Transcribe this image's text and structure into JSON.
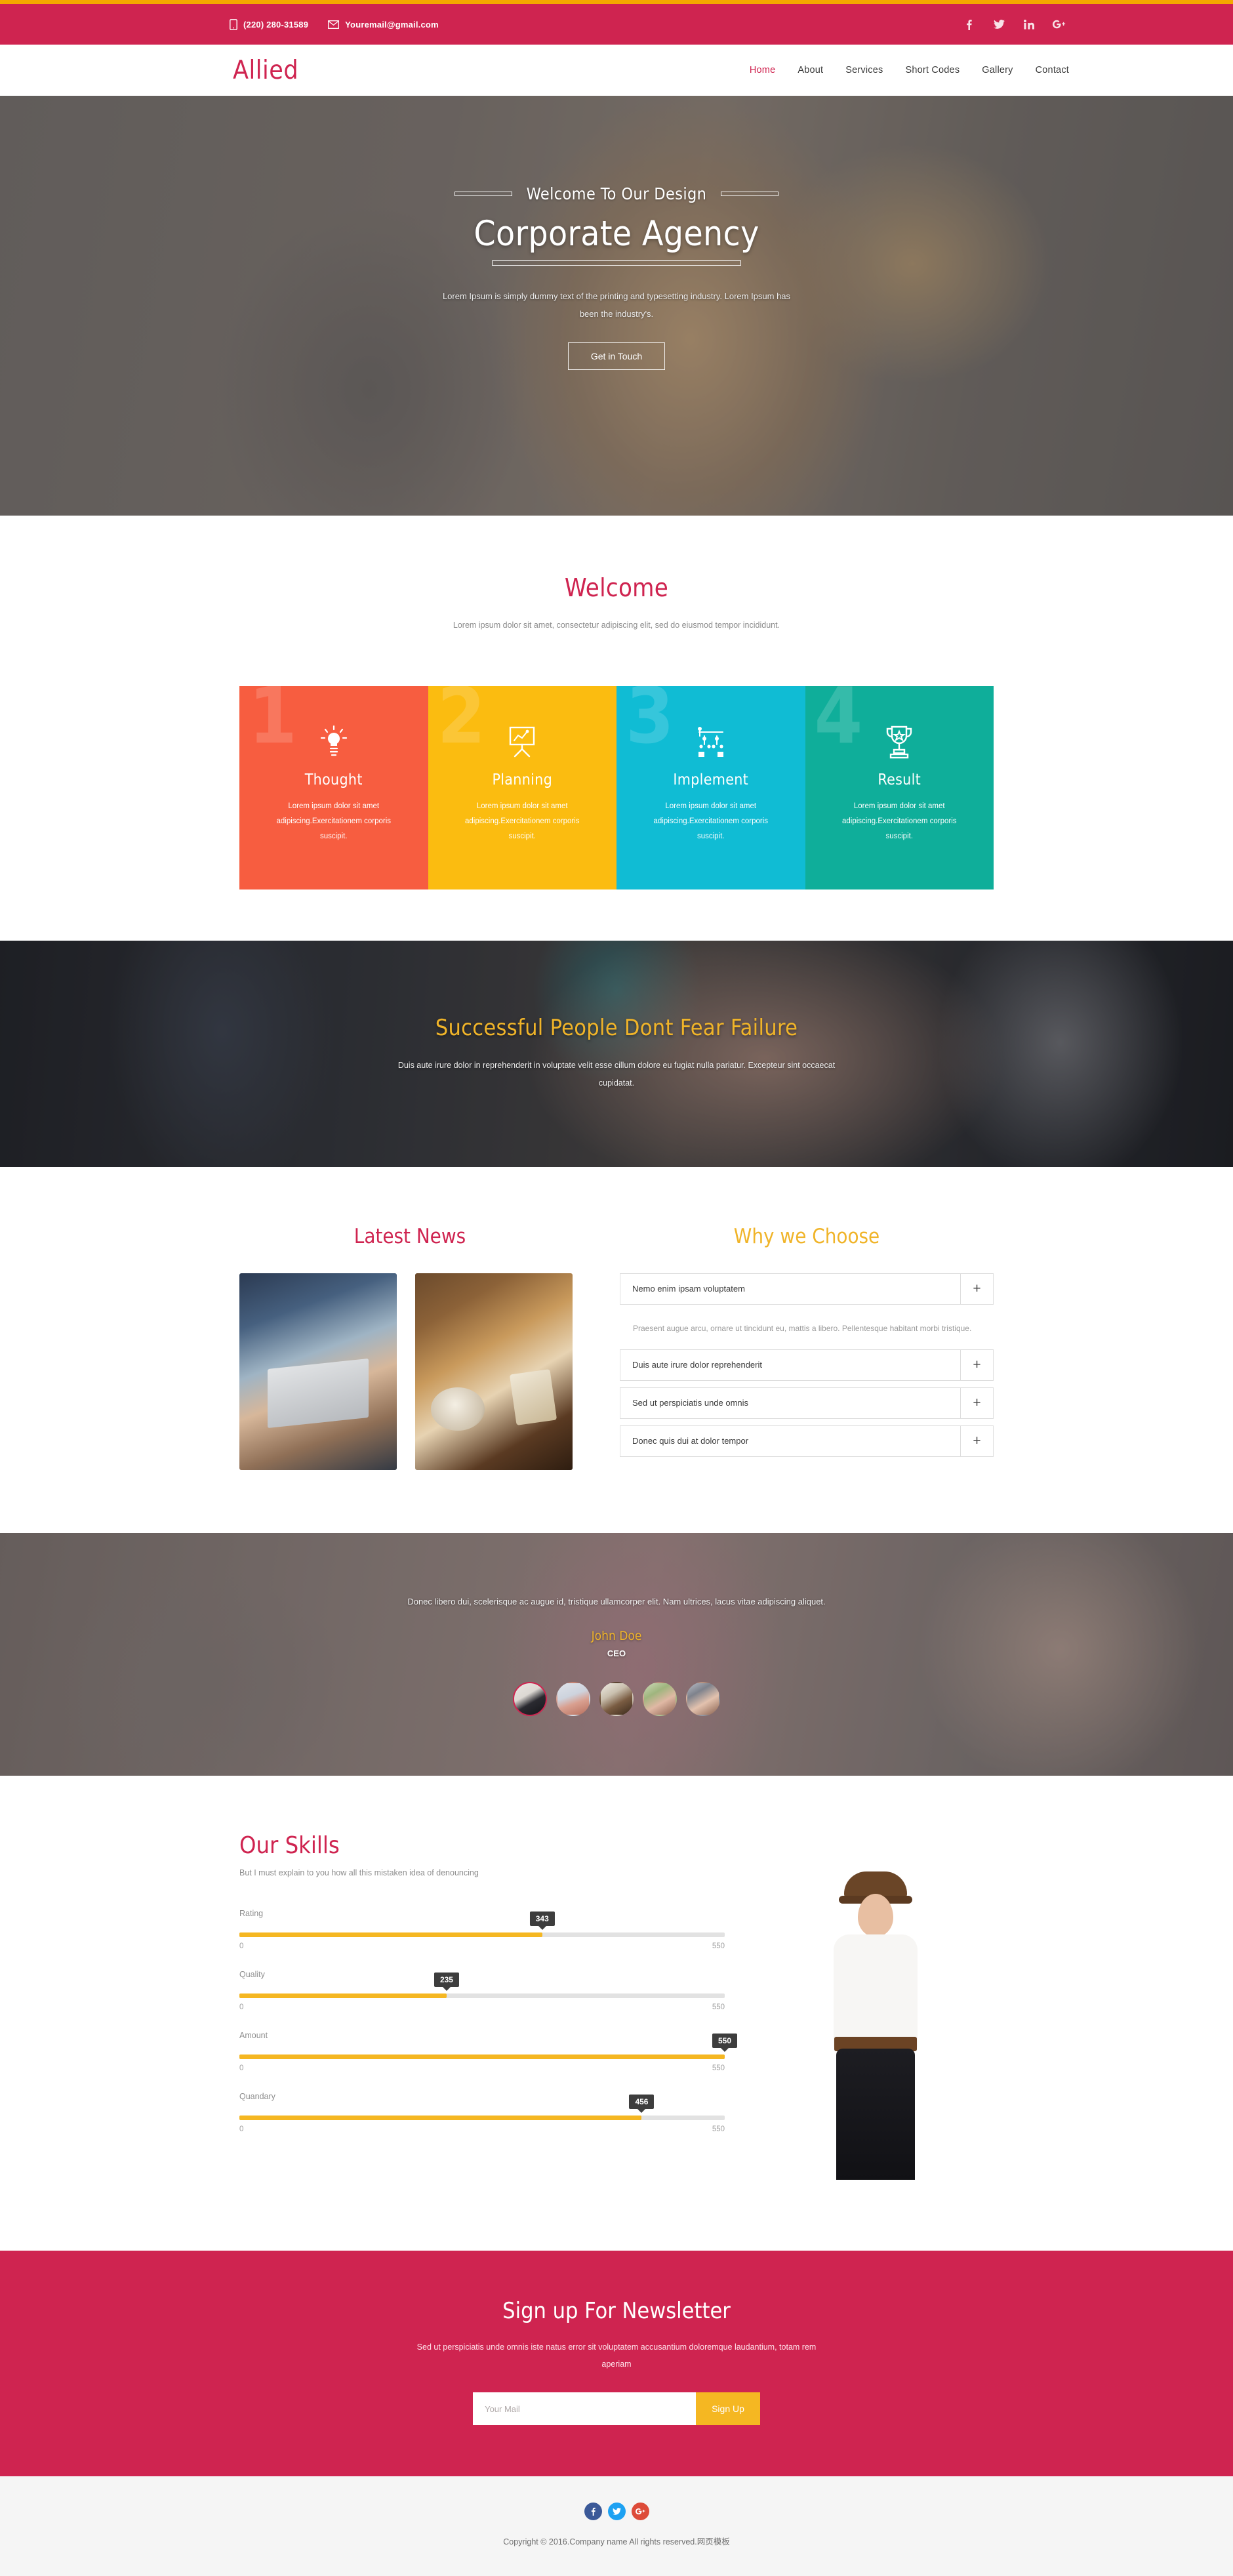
{
  "colors": {
    "brand_red": "#cf2450",
    "accent_yellow": "#f5b722",
    "card_orange": "#f75d40",
    "card_yellow": "#fbbc10",
    "card_cyan": "#10bcd4",
    "card_teal": "#0fae9a"
  },
  "topbar": {
    "phone": "(220) 280-31589",
    "email": "Youremail@gmail.com",
    "phone_icon": "mobile-phone-icon",
    "email_icon": "envelope-icon",
    "socials": [
      {
        "name": "facebook",
        "label": "f"
      },
      {
        "name": "twitter",
        "label": "t"
      },
      {
        "name": "linkedin",
        "label": "in"
      },
      {
        "name": "googleplus",
        "label": "g+"
      }
    ]
  },
  "header": {
    "logo": "Allied",
    "nav": [
      {
        "label": "Home",
        "active": true
      },
      {
        "label": "About",
        "active": false
      },
      {
        "label": "Services",
        "active": false
      },
      {
        "label": "Short Codes",
        "active": false
      },
      {
        "label": "Gallery",
        "active": false
      },
      {
        "label": "Contact",
        "active": false
      }
    ]
  },
  "hero": {
    "kicker": "Welcome To Our Design",
    "title": "Corporate Agency",
    "description": "Lorem Ipsum is simply dummy text of the printing and typesetting industry. Lorem Ipsum has been the industry's.",
    "button": "Get in Touch"
  },
  "welcome": {
    "title": "Welcome",
    "subtitle": "Lorem ipsum dolor sit amet, consectetur adipiscing elit, sed do eiusmod tempor incididunt.",
    "cards": [
      {
        "number": "1",
        "title": "Thought",
        "text": "Lorem ipsum dolor sit amet adipiscing.Exercitationem corporis suscipit.",
        "icon": "lightbulb-icon",
        "color": "#f75d40"
      },
      {
        "number": "2",
        "title": "Planning",
        "text": "Lorem ipsum dolor sit amet adipiscing.Exercitationem corporis suscipit.",
        "icon": "presentation-board-icon",
        "color": "#fbbc10"
      },
      {
        "number": "3",
        "title": "Implement",
        "text": "Lorem ipsum dolor sit amet adipiscing.Exercitationem corporis suscipit.",
        "icon": "org-chart-icon",
        "color": "#10bcd4"
      },
      {
        "number": "4",
        "title": "Result",
        "text": "Lorem ipsum dolor sit amet adipiscing.Exercitationem corporis suscipit.",
        "icon": "trophy-icon",
        "color": "#0fae9a"
      }
    ]
  },
  "parallax": {
    "title": "Successful People Dont Fear Failure",
    "text": "Duis aute irure dolor in reprehenderit in voluptate velit esse cillum dolore eu fugiat nulla pariatur. Excepteur sint occaecat cupidatat."
  },
  "news": {
    "title": "Latest News",
    "images": [
      {
        "name": "news-image-laptop-hands"
      },
      {
        "name": "news-image-desk-coffee"
      }
    ]
  },
  "choose": {
    "title": "Why we Choose",
    "items": [
      {
        "label": "Nemo enim ipsam voluptatem",
        "expanded": true,
        "body": "Praesent augue arcu, ornare ut tincidunt eu, mattis a libero. Pellentesque habitant morbi tristique.",
        "toggle": "+"
      },
      {
        "label": "Duis aute irure dolor reprehenderit",
        "expanded": false,
        "toggle": "+"
      },
      {
        "label": "Sed ut perspiciatis unde omnis",
        "expanded": false,
        "toggle": "+"
      },
      {
        "label": "Donec quis dui at dolor tempor",
        "expanded": false,
        "toggle": "+"
      }
    ]
  },
  "testimonial": {
    "quote": "Donec libero dui, scelerisque ac augue id, tristique ullamcorper elit. Nam ultrices, lacus vitae adipiscing aliquet.",
    "name": "John Doe",
    "role": "CEO",
    "avatars": [
      {
        "name": "avatar-1",
        "active": true
      },
      {
        "name": "avatar-2",
        "active": false
      },
      {
        "name": "avatar-3",
        "active": false
      },
      {
        "name": "avatar-4",
        "active": false
      },
      {
        "name": "avatar-5",
        "active": false
      }
    ]
  },
  "skills": {
    "title": "Our Skills",
    "subtitle": "But I must explain to you how all this mistaken idea of denouncing",
    "image_name": "woman-with-hat-photo",
    "sliders": [
      {
        "label": "Rating",
        "value": "343",
        "min": "0",
        "max": "550",
        "percent": 62.4
      },
      {
        "label": "Quality",
        "value": "235",
        "min": "0",
        "max": "550",
        "percent": 42.7
      },
      {
        "label": "Amount",
        "value": "550",
        "min": "0",
        "max": "550",
        "percent": 100
      },
      {
        "label": "Quandary",
        "value": "456",
        "min": "0",
        "max": "550",
        "percent": 82.9
      }
    ]
  },
  "newsletter": {
    "title": "Sign up For Newsletter",
    "subtitle": "Sed ut perspiciatis unde omnis iste natus error sit voluptatem accusantium doloremque laudantium, totam rem aperiam",
    "placeholder": "Your Mail",
    "input_value": "",
    "button": "Sign Up"
  },
  "footer": {
    "socials": [
      {
        "name": "facebook",
        "label": "f"
      },
      {
        "name": "twitter",
        "label": "t"
      },
      {
        "name": "googleplus",
        "label": "g+"
      }
    ],
    "copyright": "Copyright © 2016.Company name All rights reserved.网页模板"
  }
}
